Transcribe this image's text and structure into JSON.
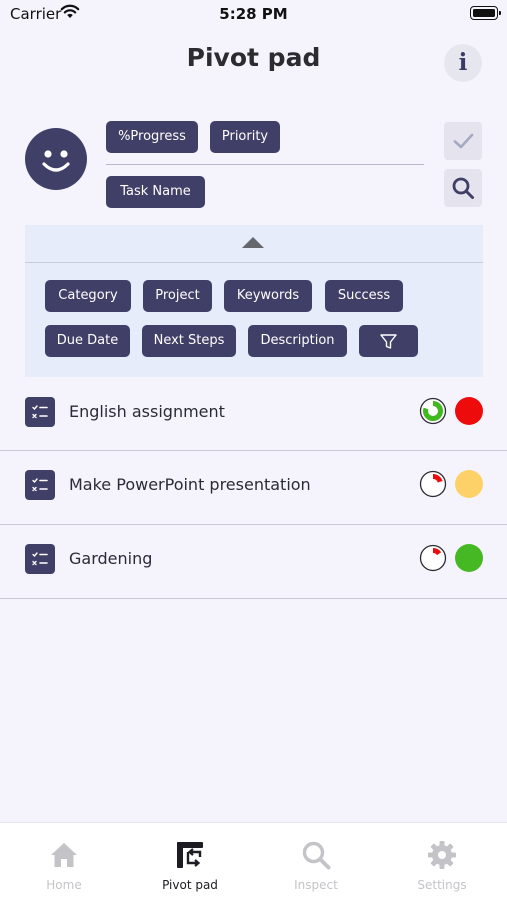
{
  "status_bar": {
    "carrier": "Carrier",
    "time": "5:28 PM"
  },
  "header": {
    "title": "Pivot pad",
    "info_label": "i"
  },
  "pivot": {
    "row_fields": [
      "%Progress",
      "Priority"
    ],
    "column_fields": [
      "Task Name"
    ]
  },
  "filter_panel": {
    "chips": [
      "Category",
      "Project",
      "Keywords",
      "Success",
      "Due Date",
      "Next Steps",
      "Description"
    ]
  },
  "tasks": [
    {
      "name": "English assignment",
      "progress": 0.8,
      "progress_color": "#41b81d",
      "priority_color": "#ee0b0b"
    },
    {
      "name": "Make PowerPoint presentation",
      "progress": 0.2,
      "progress_color": "#ee0b0b",
      "priority_color": "#fdd167"
    },
    {
      "name": "Gardening",
      "progress": 0.15,
      "progress_color": "#ee0b0b",
      "priority_color": "#45b823"
    }
  ],
  "tabbar": {
    "tabs": [
      {
        "label": "Home",
        "icon": "home-icon",
        "active": false
      },
      {
        "label": "Pivot pad",
        "icon": "pivot-icon",
        "active": true
      },
      {
        "label": "Inspect",
        "icon": "search-icon",
        "active": false
      },
      {
        "label": "Settings",
        "icon": "gear-icon",
        "active": false
      }
    ]
  },
  "colors": {
    "accent": "#403f68",
    "background": "#f5f4fd",
    "panel": "#e6ecfa"
  }
}
